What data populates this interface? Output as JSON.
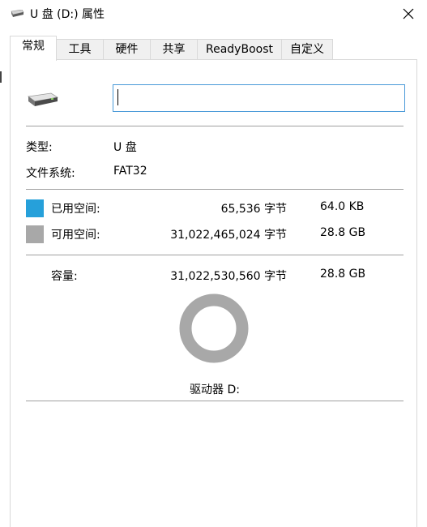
{
  "window": {
    "title": "U 盘 (D:) 属性"
  },
  "tabs": [
    {
      "label": "常规",
      "active": true
    },
    {
      "label": "工具"
    },
    {
      "label": "硬件"
    },
    {
      "label": "共享"
    },
    {
      "label": "ReadyBoost"
    },
    {
      "label": "自定义"
    }
  ],
  "general": {
    "name_value": "",
    "type_label": "类型:",
    "type_value": "U 盘",
    "fs_label": "文件系统:",
    "fs_value": "FAT32",
    "used": {
      "label": "已用空间:",
      "bytes": "65,536 字节",
      "size": "64.0 KB",
      "color": "#26a0da"
    },
    "free": {
      "label": "可用空间:",
      "bytes": "31,022,465,024 字节",
      "size": "28.8 GB",
      "color": "#a8a8a8"
    },
    "capacity": {
      "label": "容量:",
      "bytes": "31,022,530,560 字节",
      "size": "28.8 GB"
    },
    "drive_label": "驱动器 D:",
    "used_fraction": 2.1e-06
  },
  "icons": [
    "drive-icon",
    "close-icon"
  ]
}
